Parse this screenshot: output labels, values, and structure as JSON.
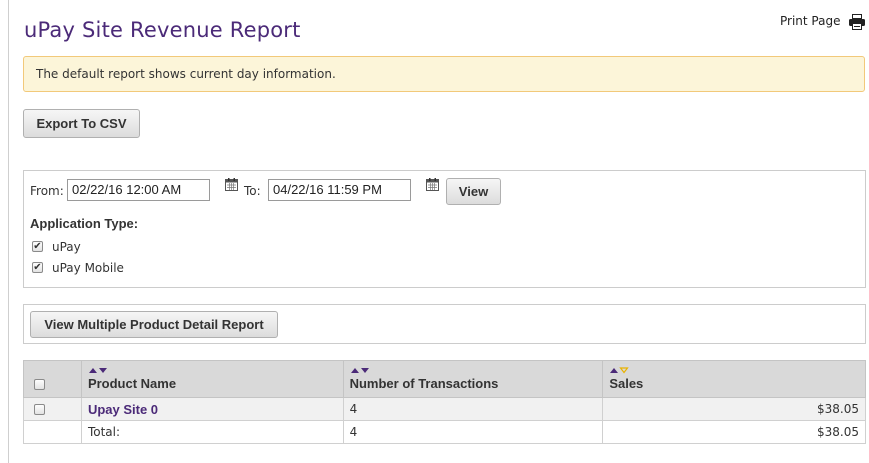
{
  "header": {
    "title": "uPay Site Revenue Report",
    "print_label": "Print Page"
  },
  "notice": {
    "text": "The default report shows current day information."
  },
  "toolbar": {
    "export_label": "Export To CSV"
  },
  "filters": {
    "from_label": "From:",
    "from_value": "02/22/16 12:00 AM",
    "to_label": "To:",
    "to_value": "04/22/16 11:59 PM",
    "view_label": "View",
    "app_type_label": "Application Type:",
    "app_types": [
      {
        "label": "uPay",
        "checked": true
      },
      {
        "label": "uPay Mobile",
        "checked": true
      }
    ]
  },
  "detail": {
    "button_label": "View Multiple Product Detail Report"
  },
  "table": {
    "columns": [
      "Product Name",
      "Number of Transactions",
      "Sales"
    ],
    "rows": [
      {
        "product": "Upay Site 0",
        "transactions": "4",
        "sales": "$38.05"
      }
    ],
    "total": {
      "label": "Total:",
      "transactions": "4",
      "sales": "$38.05"
    }
  },
  "colors": {
    "title": "#4b2a78",
    "sort_arrow": "#4b2a78",
    "sort_arrow_active": "#e9b200",
    "notice_bg": "#fcf5d9",
    "notice_border": "#f2c97a"
  },
  "icons": [
    "printer-icon",
    "calendar-icon",
    "sort-arrows-icon",
    "checkbox"
  ]
}
